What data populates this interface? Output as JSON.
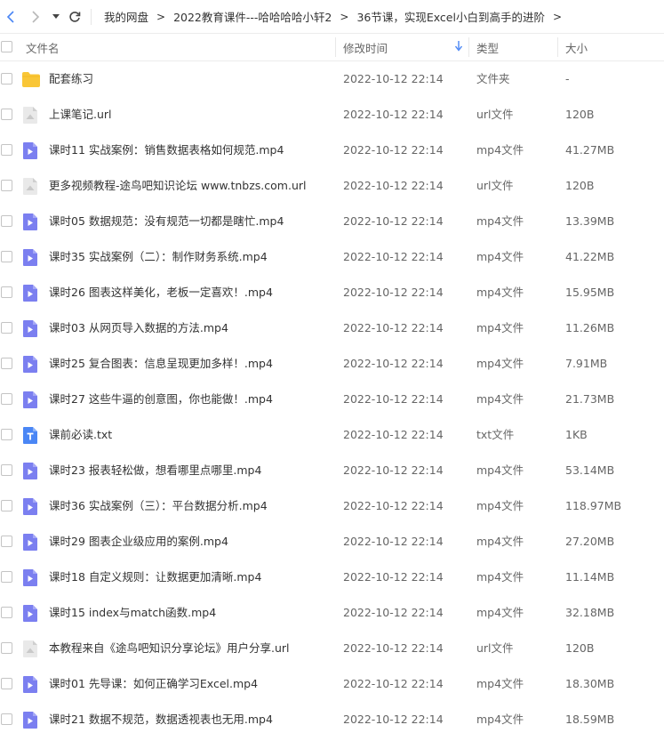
{
  "breadcrumb": {
    "items": [
      "我的网盘",
      "2022教育课件---哈哈哈哈小轩2",
      "36节课，实现Excel小白到高手的进阶"
    ],
    "separator": ">"
  },
  "columns": {
    "name": "文件名",
    "modified": "修改时间",
    "type": "类型",
    "size": "大小"
  },
  "colors": {
    "accent": "#4a86f5",
    "video_icon": "#7b7ff0",
    "folder_icon": "#f9c637",
    "url_icon": "#cfcfcf"
  },
  "files": [
    {
      "name": "配套练习",
      "modified": "2022-10-12 22:14",
      "type": "文件夹",
      "size": "-",
      "icon": "folder-icon"
    },
    {
      "name": "上课笔记.url",
      "modified": "2022-10-12 22:14",
      "type": "url文件",
      "size": "120B",
      "icon": "url-file-icon"
    },
    {
      "name": "课时11 实战案例：销售数据表格如何规范.mp4",
      "modified": "2022-10-12 22:14",
      "type": "mp4文件",
      "size": "41.27MB",
      "icon": "video-file-icon"
    },
    {
      "name": "更多视频教程-途鸟吧知识论坛 www.tnbzs.com.url",
      "modified": "2022-10-12 22:14",
      "type": "url文件",
      "size": "120B",
      "icon": "url-file-icon"
    },
    {
      "name": "课时05 数据规范：没有规范一切都是瞎忙.mp4",
      "modified": "2022-10-12 22:14",
      "type": "mp4文件",
      "size": "13.39MB",
      "icon": "video-file-icon"
    },
    {
      "name": "课时35 实战案例（二）：制作财务系统.mp4",
      "modified": "2022-10-12 22:14",
      "type": "mp4文件",
      "size": "41.22MB",
      "icon": "video-file-icon"
    },
    {
      "name": "课时26 图表这样美化，老板一定喜欢！.mp4",
      "modified": "2022-10-12 22:14",
      "type": "mp4文件",
      "size": "15.95MB",
      "icon": "video-file-icon"
    },
    {
      "name": "课时03 从网页导入数据的方法.mp4",
      "modified": "2022-10-12 22:14",
      "type": "mp4文件",
      "size": "11.26MB",
      "icon": "video-file-icon"
    },
    {
      "name": "课时25 复合图表：信息呈现更加多样！.mp4",
      "modified": "2022-10-12 22:14",
      "type": "mp4文件",
      "size": "7.91MB",
      "icon": "video-file-icon"
    },
    {
      "name": "课时27 这些牛逼的创意图，你也能做！.mp4",
      "modified": "2022-10-12 22:14",
      "type": "mp4文件",
      "size": "21.73MB",
      "icon": "video-file-icon"
    },
    {
      "name": "课前必读.txt",
      "modified": "2022-10-12 22:14",
      "type": "txt文件",
      "size": "1KB",
      "icon": "text-file-icon"
    },
    {
      "name": "课时23 报表轻松做，想看哪里点哪里.mp4",
      "modified": "2022-10-12 22:14",
      "type": "mp4文件",
      "size": "53.14MB",
      "icon": "video-file-icon"
    },
    {
      "name": "课时36 实战案例（三）：平台数据分析.mp4",
      "modified": "2022-10-12 22:14",
      "type": "mp4文件",
      "size": "118.97MB",
      "icon": "video-file-icon"
    },
    {
      "name": "课时29 图表企业级应用的案例.mp4",
      "modified": "2022-10-12 22:14",
      "type": "mp4文件",
      "size": "27.20MB",
      "icon": "video-file-icon"
    },
    {
      "name": "课时18 自定义规则：让数据更加清晰.mp4",
      "modified": "2022-10-12 22:14",
      "type": "mp4文件",
      "size": "11.14MB",
      "icon": "video-file-icon"
    },
    {
      "name": "课时15 index与match函数.mp4",
      "modified": "2022-10-12 22:14",
      "type": "mp4文件",
      "size": "32.18MB",
      "icon": "video-file-icon"
    },
    {
      "name": "本教程来自《途鸟吧知识分享论坛》用户分享.url",
      "modified": "2022-10-12 22:14",
      "type": "url文件",
      "size": "120B",
      "icon": "url-file-icon"
    },
    {
      "name": "课时01 先导课：如何正确学习Excel.mp4",
      "modified": "2022-10-12 22:14",
      "type": "mp4文件",
      "size": "18.30MB",
      "icon": "video-file-icon"
    },
    {
      "name": "课时21 数据不规范，数据透视表也无用.mp4",
      "modified": "2022-10-12 22:14",
      "type": "mp4文件",
      "size": "18.59MB",
      "icon": "video-file-icon"
    }
  ]
}
